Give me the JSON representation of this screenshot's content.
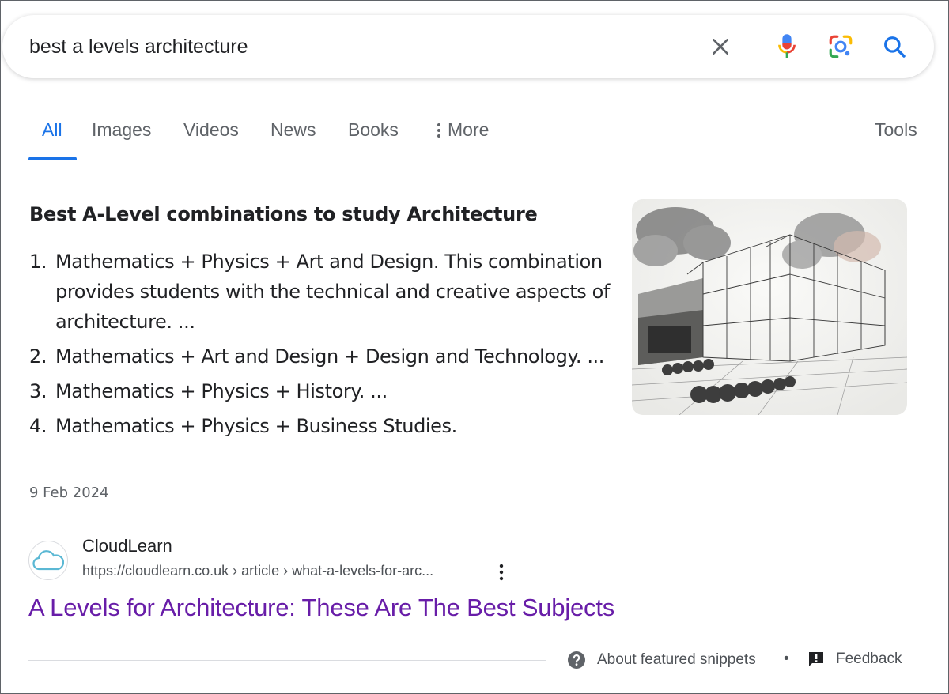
{
  "search": {
    "query": "best a levels architecture",
    "icons": [
      "close-icon",
      "mic-icon",
      "lens-icon",
      "search-icon"
    ]
  },
  "tabs": [
    {
      "label": "All",
      "active": true
    },
    {
      "label": "Images"
    },
    {
      "label": "Videos"
    },
    {
      "label": "News"
    },
    {
      "label": "Books"
    },
    {
      "label": "More"
    },
    {
      "label": "Tools"
    }
  ],
  "snippet": {
    "heading": "Best A-Level combinations to study Architecture",
    "items": [
      {
        "num": "1.",
        "text": "Mathematics + Physics + Art and Design. This combination provides students with the technical and creative aspects of architecture. ..."
      },
      {
        "num": "2.",
        "text": "Mathematics + Art and Design + Design and Technology. ..."
      },
      {
        "num": "3.",
        "text": "Mathematics + Physics + History. ..."
      },
      {
        "num": "4.",
        "text": "Mathematics + Physics + Business Studies."
      }
    ],
    "date": "9 Feb 2024",
    "image": "architecture-sketch-image"
  },
  "source": {
    "site_name": "CloudLearn",
    "url": "https://cloudlearn.co.uk › article › what-a-levels-for-arc...",
    "title": "A Levels for Architecture: These Are The Best Subjects",
    "favicon": "cloud-icon"
  },
  "footer": {
    "about_label": "About featured snippets",
    "separator": "•",
    "feedback_label": "Feedback"
  },
  "colors": {
    "accent": "#1a73e8",
    "visited_link": "#681da8",
    "text": "#202124",
    "muted": "#5f6368"
  }
}
